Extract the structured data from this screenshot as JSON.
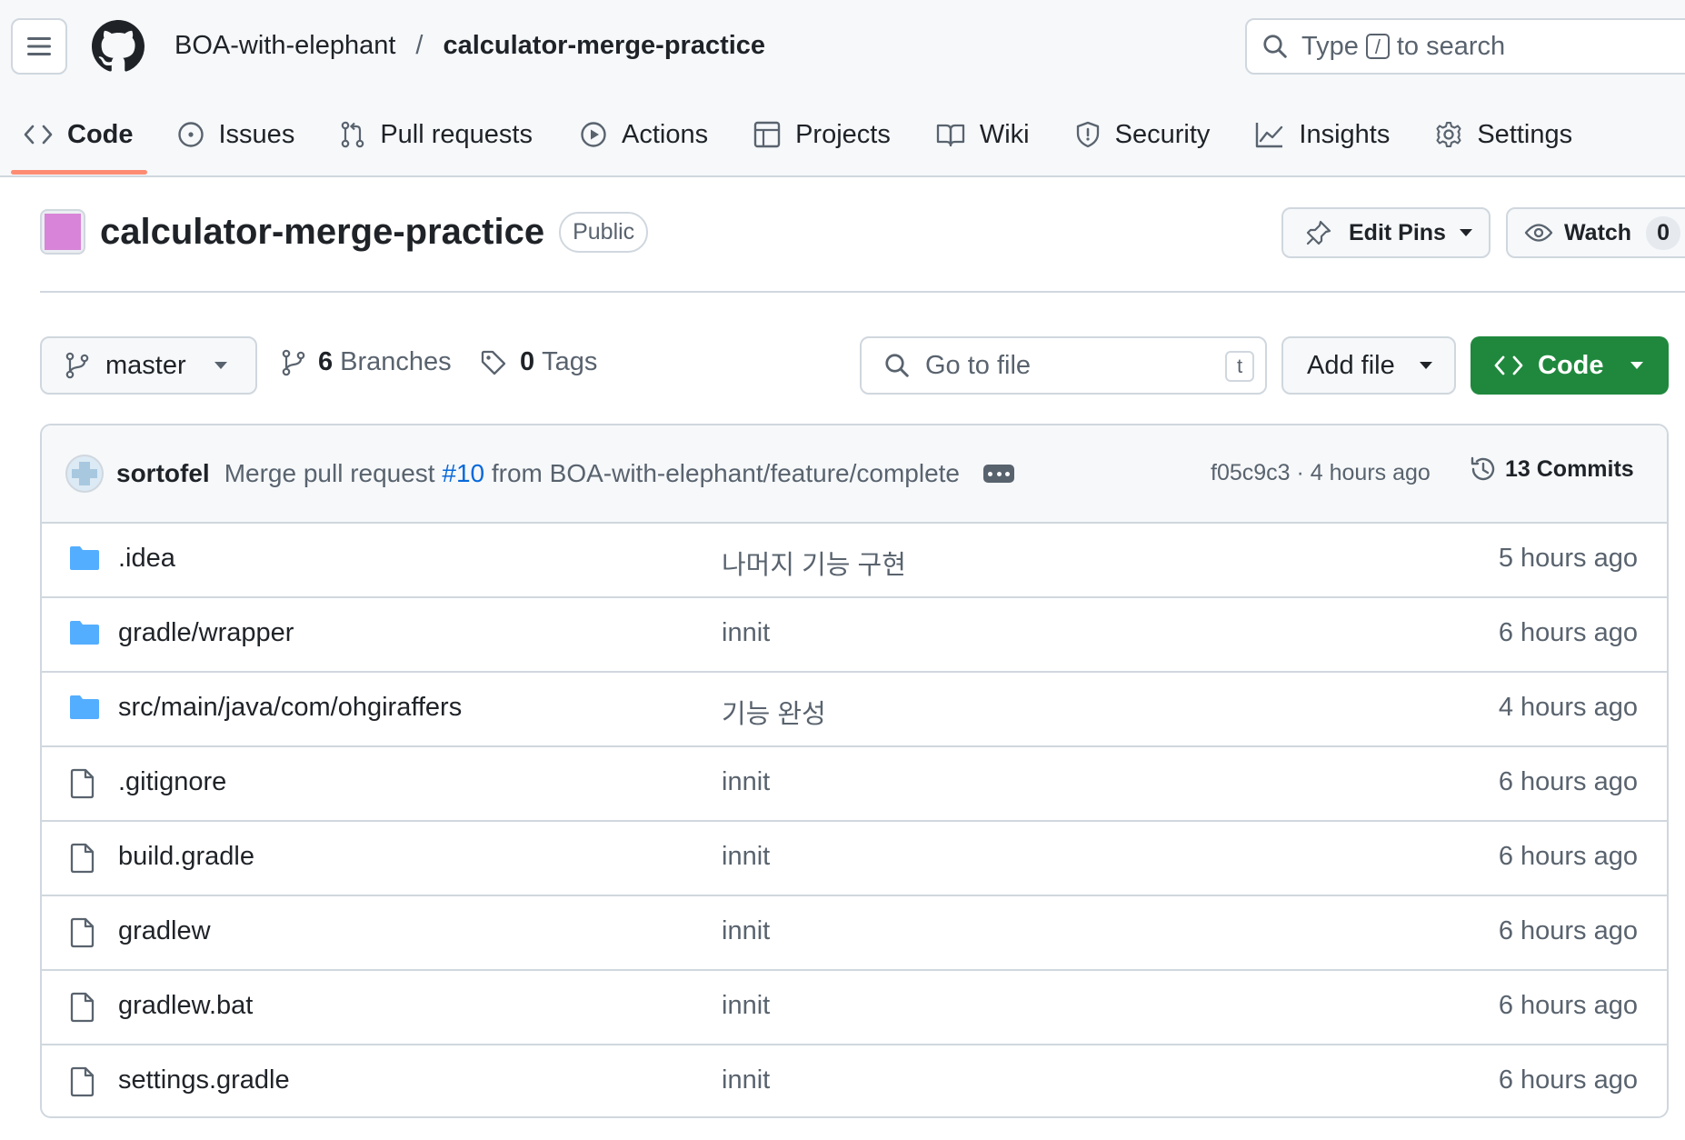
{
  "header": {
    "owner": "BOA-with-elephant",
    "separator": "/",
    "repo": "calculator-merge-practice",
    "search": {
      "prefix": "Type",
      "key": "/",
      "suffix": "to search"
    }
  },
  "tabs": [
    {
      "label": "Code",
      "icon": "code-icon",
      "active": true
    },
    {
      "label": "Issues",
      "icon": "issue-icon"
    },
    {
      "label": "Pull requests",
      "icon": "pull-request-icon"
    },
    {
      "label": "Actions",
      "icon": "play-icon"
    },
    {
      "label": "Projects",
      "icon": "table-icon"
    },
    {
      "label": "Wiki",
      "icon": "book-icon"
    },
    {
      "label": "Security",
      "icon": "shield-icon"
    },
    {
      "label": "Insights",
      "icon": "graph-icon"
    },
    {
      "label": "Settings",
      "icon": "gear-icon"
    }
  ],
  "repo_header": {
    "name": "calculator-merge-practice",
    "visibility": "Public",
    "edit_pins": "Edit Pins",
    "watch": "Watch",
    "watch_count": "0"
  },
  "toolbar": {
    "branch": "master",
    "branches_count": "6",
    "branches_label": "Branches",
    "tags_count": "0",
    "tags_label": "Tags",
    "go_to_file": "Go to file",
    "go_to_file_key": "t",
    "add_file": "Add file",
    "code": "Code"
  },
  "latest_commit": {
    "author": "sortofel",
    "message_prefix": "Merge pull request",
    "pr": "#10",
    "message_suffix": "from BOA-with-elephant/feature/complete",
    "sha_age": "f05c9c3 · 4 hours ago",
    "commits": "13 Commits"
  },
  "files": [
    {
      "type": "dir",
      "name": ".idea",
      "message": "나머지 기능 구현",
      "age": "5 hours ago"
    },
    {
      "type": "dir",
      "name": "gradle/wrapper",
      "message": "innit",
      "age": "6 hours ago"
    },
    {
      "type": "dir",
      "name": "src/main/java/com/ohgiraffers",
      "message": "기능 완성",
      "age": "4 hours ago"
    },
    {
      "type": "file",
      "name": ".gitignore",
      "message": "innit",
      "age": "6 hours ago"
    },
    {
      "type": "file",
      "name": "build.gradle",
      "message": "innit",
      "age": "6 hours ago"
    },
    {
      "type": "file",
      "name": "gradlew",
      "message": "innit",
      "age": "6 hours ago"
    },
    {
      "type": "file",
      "name": "gradlew.bat",
      "message": "innit",
      "age": "6 hours ago"
    },
    {
      "type": "file",
      "name": "settings.gradle",
      "message": "innit",
      "age": "6 hours ago"
    }
  ],
  "colors": {
    "accent_green": "#1f883d",
    "link_blue": "#0969da",
    "folder_blue": "#54aeff",
    "active_tab_underline": "#fd8c73"
  }
}
